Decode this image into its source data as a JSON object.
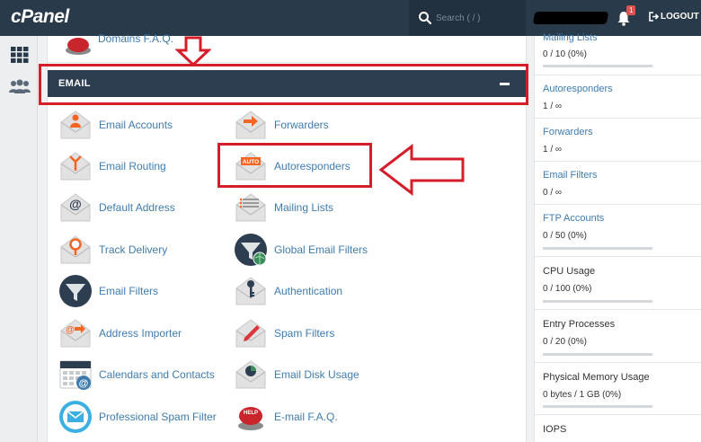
{
  "topbar": {
    "logo": "cPanel",
    "search_placeholder": "Search ( / )",
    "logout": "LOGOUT",
    "notification_count": "1"
  },
  "main": {
    "prev_item": "Domains F.A.Q.",
    "section_title": "EMAIL",
    "items": [
      {
        "label": "Email Accounts",
        "icon": "envelope-person-icon"
      },
      {
        "label": "Forwarders",
        "icon": "envelope-arrow-icon"
      },
      {
        "label": "Email Routing",
        "icon": "envelope-routing-icon"
      },
      {
        "label": "Autoresponders",
        "icon": "envelope-auto-icon"
      },
      {
        "label": "Default Address",
        "icon": "envelope-at-icon"
      },
      {
        "label": "Mailing Lists",
        "icon": "envelope-list-icon"
      },
      {
        "label": "Track Delivery",
        "icon": "envelope-pin-icon"
      },
      {
        "label": "Global Email Filters",
        "icon": "funnel-globe-icon"
      },
      {
        "label": "Email Filters",
        "icon": "funnel-icon"
      },
      {
        "label": "Authentication",
        "icon": "envelope-key-icon"
      },
      {
        "label": "Address Importer",
        "icon": "envelope-import-icon"
      },
      {
        "label": "Spam Filters",
        "icon": "envelope-pencil-icon"
      },
      {
        "label": "Calendars and Contacts",
        "icon": "calendar-at-icon"
      },
      {
        "label": "Email Disk Usage",
        "icon": "envelope-pie-icon"
      },
      {
        "label": "Professional Spam Filter",
        "icon": "spam-shield-icon"
      },
      {
        "label": "E-mail F.A.Q.",
        "icon": "help-button-icon"
      }
    ],
    "icon_auto_text": "AUTO",
    "icon_help_text": "HELP"
  },
  "sidebar": {
    "stats": [
      {
        "title": "Mailing Lists",
        "value": "0 / 10   (0%)",
        "bar": true,
        "usage": 0
      },
      {
        "title": "Autoresponders",
        "value": "1 / ∞",
        "bar": false
      },
      {
        "title": "Forwarders",
        "value": "1 / ∞",
        "bar": false
      },
      {
        "title": "Email Filters",
        "value": "0 / ∞",
        "bar": false
      },
      {
        "title": "FTP Accounts",
        "value": "0 / 50   (0%)",
        "bar": true,
        "usage": 0
      },
      {
        "title": "CPU Usage",
        "value": "0 / 100   (0%)",
        "bar": true,
        "usage": 0
      },
      {
        "title": "Entry Processes",
        "value": "0 / 20   (0%)",
        "bar": true,
        "usage": 0
      },
      {
        "title": "Physical Memory Usage",
        "value": "0 bytes / 1 GB   (0%)",
        "bar": true,
        "usage": 0
      },
      {
        "title": "IOPS",
        "value": "",
        "bar": false
      }
    ]
  },
  "colors": {
    "topbar": "#293a4a",
    "header": "#2c3e50",
    "link": "#3f7cae",
    "annotation": "#d61d2a",
    "icon_orange": "#f26522"
  }
}
